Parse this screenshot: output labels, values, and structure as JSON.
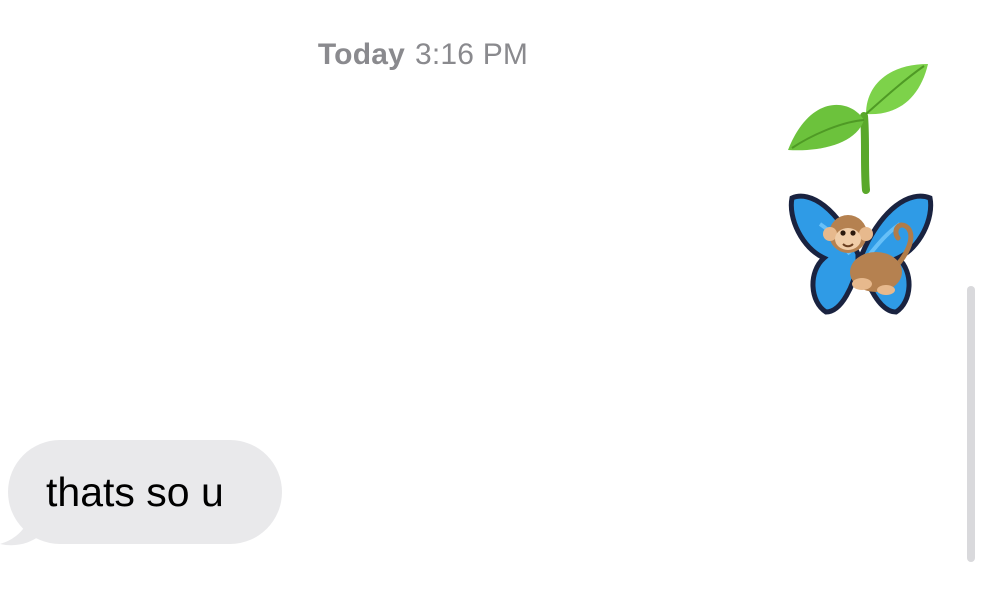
{
  "conversation": {
    "timestamp": {
      "day": "Today",
      "time": "3:16 PM"
    },
    "sent_emojis": [
      {
        "icon": "seedling-icon"
      },
      {
        "icon": "butterfly-icon"
      },
      {
        "icon": "monkey-icon"
      }
    ],
    "received_messages": [
      {
        "text": "thats so u"
      }
    ]
  },
  "colors": {
    "received_bubble": "#e9e9eb",
    "timestamp_text": "#8a8a8e",
    "butterfly_blue": "#2f9be6",
    "seedling_green": "#6cc23c"
  }
}
